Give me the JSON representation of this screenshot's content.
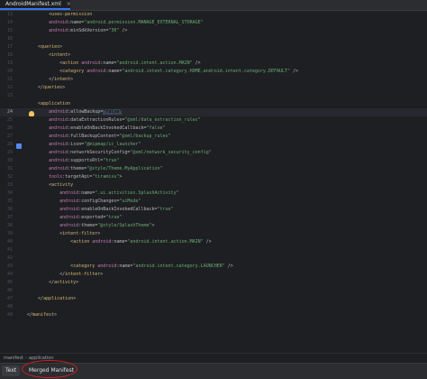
{
  "tab": {
    "filename": "AndroidManifest.xml",
    "close": "×",
    "icon": "xml-file-icon"
  },
  "lines": [
    {
      "n": "13",
      "current": false,
      "tokens": [
        [
          "p",
          "        <"
        ],
        [
          "t",
          "uses-permission"
        ]
      ]
    },
    {
      "n": "14",
      "current": false,
      "tokens": [
        [
          "p",
          "        "
        ],
        [
          "ns",
          "android"
        ],
        [
          "a",
          ":name="
        ],
        [
          "s",
          "\"android.permission.MANAGE_EXTERNAL_STORAGE\""
        ]
      ]
    },
    {
      "n": "15",
      "current": false,
      "tokens": [
        [
          "p",
          "        "
        ],
        [
          "ns",
          "android"
        ],
        [
          "a",
          ":minSdkVersion="
        ],
        [
          "s",
          "\"30\""
        ],
        [
          "p",
          " />"
        ]
      ]
    },
    {
      "n": "16",
      "current": false,
      "tokens": []
    },
    {
      "n": "17",
      "current": false,
      "tokens": [
        [
          "p",
          "    <"
        ],
        [
          "t",
          "queries"
        ],
        [
          "p",
          ">"
        ]
      ]
    },
    {
      "n": "18",
      "current": false,
      "tokens": [
        [
          "p",
          "        <"
        ],
        [
          "t",
          "intent"
        ],
        [
          "p",
          ">"
        ]
      ]
    },
    {
      "n": "19",
      "current": false,
      "tokens": [
        [
          "p",
          "            <"
        ],
        [
          "t",
          "action "
        ],
        [
          "ns",
          "android"
        ],
        [
          "a",
          ":name="
        ],
        [
          "s",
          "\"android.intent.action.MAIN\""
        ],
        [
          "p",
          " />"
        ]
      ]
    },
    {
      "n": "20",
      "current": false,
      "tokens": [
        [
          "p",
          "            <"
        ],
        [
          "t",
          "category "
        ],
        [
          "ns",
          "android"
        ],
        [
          "a",
          ":name="
        ],
        [
          "s",
          "\"android.intent.category.HOME,android.intent.category.DEFAULT\""
        ],
        [
          "p",
          " />"
        ]
      ]
    },
    {
      "n": "21",
      "current": false,
      "tokens": [
        [
          "p",
          "        </"
        ],
        [
          "t",
          "intent"
        ],
        [
          "p",
          ">"
        ]
      ]
    },
    {
      "n": "22",
      "current": false,
      "tokens": [
        [
          "p",
          "    </"
        ],
        [
          "t",
          "queries"
        ],
        [
          "p",
          ">"
        ]
      ]
    },
    {
      "n": "23",
      "current": false,
      "tokens": []
    },
    {
      "n": "",
      "current": false,
      "tokens": [
        [
          "p",
          "    <"
        ],
        [
          "t",
          "application"
        ]
      ]
    },
    {
      "n": "24",
      "current": true,
      "tokens": [
        [
          "p",
          "        "
        ],
        [
          "ns",
          "android"
        ],
        [
          "a",
          ":allowBackup="
        ],
        [
          "hl",
          "\"false\""
        ]
      ]
    },
    {
      "n": "25",
      "current": false,
      "tokens": [
        [
          "p",
          "        "
        ],
        [
          "ns",
          "android"
        ],
        [
          "a",
          ":dataExtractionRules="
        ],
        [
          "s",
          "\"@xml/data_extraction_rules\""
        ]
      ]
    },
    {
      "n": "26",
      "current": false,
      "tokens": [
        [
          "p",
          "        "
        ],
        [
          "ns",
          "android"
        ],
        [
          "a",
          ":enableOnBackInvokedCallback="
        ],
        [
          "s",
          "\"false\""
        ]
      ]
    },
    {
      "n": "27",
      "current": false,
      "tokens": [
        [
          "p",
          "        "
        ],
        [
          "ns",
          "android"
        ],
        [
          "a",
          ":fullBackupContent="
        ],
        [
          "s",
          "\"@xml/backup_rules\""
        ]
      ]
    },
    {
      "n": "28",
      "current": false,
      "tokens": [
        [
          "p",
          "        "
        ],
        [
          "ns",
          "android"
        ],
        [
          "a",
          ":icon="
        ],
        [
          "s",
          "\"@mipmap/ic_launcher\""
        ]
      ]
    },
    {
      "n": "29",
      "current": false,
      "tokens": [
        [
          "p",
          "        "
        ],
        [
          "ns",
          "android"
        ],
        [
          "a",
          ":networkSecurityConfig="
        ],
        [
          "s",
          "\"@xml/network_security_config\""
        ]
      ]
    },
    {
      "n": "30",
      "current": false,
      "tokens": [
        [
          "p",
          "        "
        ],
        [
          "ns",
          "android"
        ],
        [
          "a",
          ":supportsRtl="
        ],
        [
          "s",
          "\"true\""
        ]
      ]
    },
    {
      "n": "31",
      "current": false,
      "tokens": [
        [
          "p",
          "        "
        ],
        [
          "ns",
          "android"
        ],
        [
          "a",
          ":theme="
        ],
        [
          "s",
          "\"@style/Theme.MyApplication\""
        ]
      ]
    },
    {
      "n": "32",
      "current": false,
      "tokens": [
        [
          "p",
          "        "
        ],
        [
          "ns",
          "tools"
        ],
        [
          "a",
          ":targetApi="
        ],
        [
          "s",
          "\"tiramisu\""
        ],
        [
          "p",
          ">"
        ]
      ]
    },
    {
      "n": "33",
      "current": false,
      "tokens": [
        [
          "p",
          "        <"
        ],
        [
          "t",
          "activity"
        ]
      ]
    },
    {
      "n": "34",
      "current": false,
      "tokens": [
        [
          "p",
          "            "
        ],
        [
          "ns",
          "android"
        ],
        [
          "a",
          ":name="
        ],
        [
          "s",
          "\".ui.activities.SplashActivity\""
        ]
      ]
    },
    {
      "n": "35",
      "current": false,
      "tokens": [
        [
          "p",
          "            "
        ],
        [
          "ns",
          "android"
        ],
        [
          "a",
          ":configChanges="
        ],
        [
          "s",
          "\"uiMode\""
        ]
      ]
    },
    {
      "n": "36",
      "current": false,
      "tokens": [
        [
          "p",
          "            "
        ],
        [
          "ns",
          "android"
        ],
        [
          "a",
          ":enableOnBackInvokedCallback="
        ],
        [
          "s",
          "\"true\""
        ]
      ]
    },
    {
      "n": "37",
      "current": false,
      "tokens": [
        [
          "p",
          "            "
        ],
        [
          "ns",
          "android"
        ],
        [
          "a",
          ":exported="
        ],
        [
          "s",
          "\"true\""
        ]
      ]
    },
    {
      "n": "38",
      "current": false,
      "tokens": [
        [
          "p",
          "            "
        ],
        [
          "ns",
          "android"
        ],
        [
          "a",
          ":theme="
        ],
        [
          "s",
          "\"@style/SplashTheme\""
        ],
        [
          "p",
          ">"
        ]
      ]
    },
    {
      "n": "39",
      "current": false,
      "tokens": [
        [
          "p",
          "            <"
        ],
        [
          "t",
          "intent-filter"
        ],
        [
          "p",
          ">"
        ]
      ]
    },
    {
      "n": "40",
      "current": false,
      "tokens": [
        [
          "p",
          "                <"
        ],
        [
          "t",
          "action "
        ],
        [
          "ns",
          "android"
        ],
        [
          "a",
          ":name="
        ],
        [
          "s",
          "\"android.intent.action.MAIN\""
        ],
        [
          "p",
          " />"
        ]
      ]
    },
    {
      "n": "41",
      "current": false,
      "tokens": []
    },
    {
      "n": "42",
      "current": false,
      "tokens": []
    },
    {
      "n": "43",
      "current": false,
      "tokens": [
        [
          "p",
          "                <"
        ],
        [
          "t",
          "category "
        ],
        [
          "ns",
          "android"
        ],
        [
          "a",
          ":name="
        ],
        [
          "s",
          "\"android.intent.category.LAUNCHER\""
        ],
        [
          "p",
          " />"
        ]
      ]
    },
    {
      "n": "44",
      "current": false,
      "tokens": [
        [
          "p",
          "            </"
        ],
        [
          "t",
          "intent-filter"
        ],
        [
          "p",
          ">"
        ]
      ]
    },
    {
      "n": "45",
      "current": false,
      "tokens": [
        [
          "p",
          "        </"
        ],
        [
          "t",
          "activity"
        ],
        [
          "p",
          ">"
        ]
      ]
    },
    {
      "n": "46",
      "current": false,
      "tokens": []
    },
    {
      "n": "47",
      "current": false,
      "tokens": [
        [
          "p",
          "    </"
        ],
        [
          "t",
          "application"
        ],
        [
          "p",
          ">"
        ]
      ]
    },
    {
      "n": "48",
      "current": false,
      "tokens": []
    },
    {
      "n": "49",
      "current": false,
      "tokens": [
        [
          "p",
          "</"
        ],
        [
          "t",
          "manifest"
        ],
        [
          "p",
          ">"
        ]
      ]
    }
  ],
  "gutter_icons": {
    "bulb": "lightbulb-icon",
    "android": "android-icon"
  },
  "breadcrumb": [
    "manifest",
    "application"
  ],
  "bottom_tabs": {
    "text": "Text",
    "merged": "Merged Manifest"
  },
  "colors": {
    "background": "#1e1f22",
    "tag": "#d5b778",
    "string": "#6aab73",
    "namespace": "#c77dbb",
    "annotation_circle": "#d8201d"
  }
}
